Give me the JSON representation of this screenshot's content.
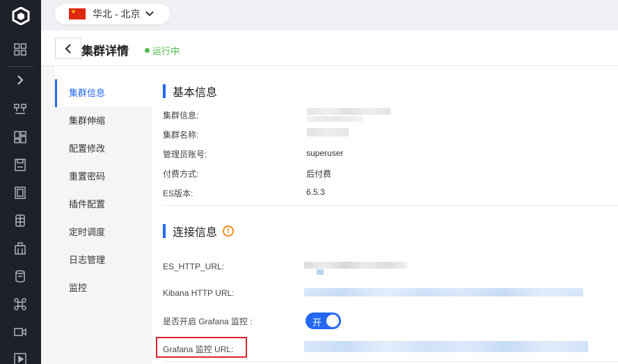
{
  "region": {
    "label": "华北 - 北京"
  },
  "header": {
    "title": "集群详情",
    "status": "运行中"
  },
  "subnav": {
    "items": [
      {
        "label": "集群信息"
      },
      {
        "label": "集群伸缩"
      },
      {
        "label": "配置修改"
      },
      {
        "label": "重置密码"
      },
      {
        "label": "插件配置"
      },
      {
        "label": "定时调度"
      },
      {
        "label": "日志管理"
      },
      {
        "label": "监控"
      }
    ]
  },
  "basic": {
    "title": "基本信息",
    "rows": [
      {
        "label": "集群信息:",
        "value": ""
      },
      {
        "label": "集群名称:",
        "value": ""
      },
      {
        "label": "管理员账号:",
        "value": "superuser"
      },
      {
        "label": "付费方式:",
        "value": "后付费"
      },
      {
        "label": "ES版本:",
        "value": "6.5.3"
      }
    ]
  },
  "connection": {
    "title": "连接信息",
    "rows": [
      {
        "label": "ES_HTTP_URL:"
      },
      {
        "label": "Kibana HTTP URL:"
      },
      {
        "label": "是否开启 Grafana 监控 :"
      },
      {
        "label": "Grafana 监控 URL:"
      }
    ],
    "toggle_label": "开"
  },
  "colors": {
    "accent": "#2468f2",
    "running": "#4fb846",
    "warning": "#f08c1c",
    "highlight": "#d9242a"
  }
}
